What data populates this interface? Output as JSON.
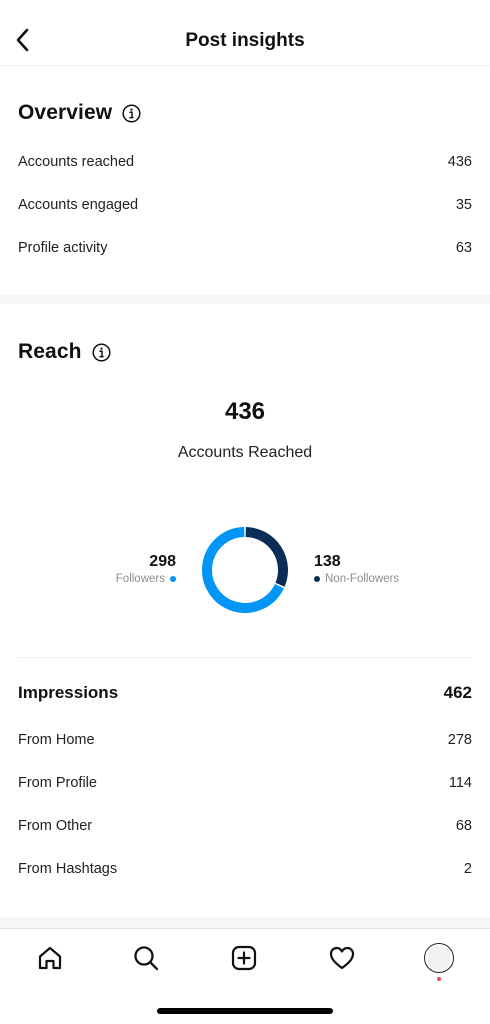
{
  "header": {
    "title": "Post insights"
  },
  "overview": {
    "title": "Overview",
    "rows": [
      {
        "label": "Accounts reached",
        "value": "436"
      },
      {
        "label": "Accounts engaged",
        "value": "35"
      },
      {
        "label": "Profile activity",
        "value": "63"
      }
    ]
  },
  "reach": {
    "title": "Reach",
    "total": "436",
    "caption": "Accounts Reached",
    "followers": {
      "value": "298",
      "label": "Followers",
      "color": "#0095f6"
    },
    "non_followers": {
      "value": "138",
      "label": "Non-Followers",
      "color": "#0a2e55"
    }
  },
  "impressions": {
    "title": "Impressions",
    "total": "462",
    "rows": [
      {
        "label": "From Home",
        "value": "278"
      },
      {
        "label": "From Profile",
        "value": "114"
      },
      {
        "label": "From Other",
        "value": "68"
      },
      {
        "label": "From Hashtags",
        "value": "2"
      }
    ]
  },
  "tabbar": {
    "items": [
      "home-icon",
      "search-icon",
      "create-icon",
      "heart-icon",
      "profile-avatar"
    ]
  }
}
